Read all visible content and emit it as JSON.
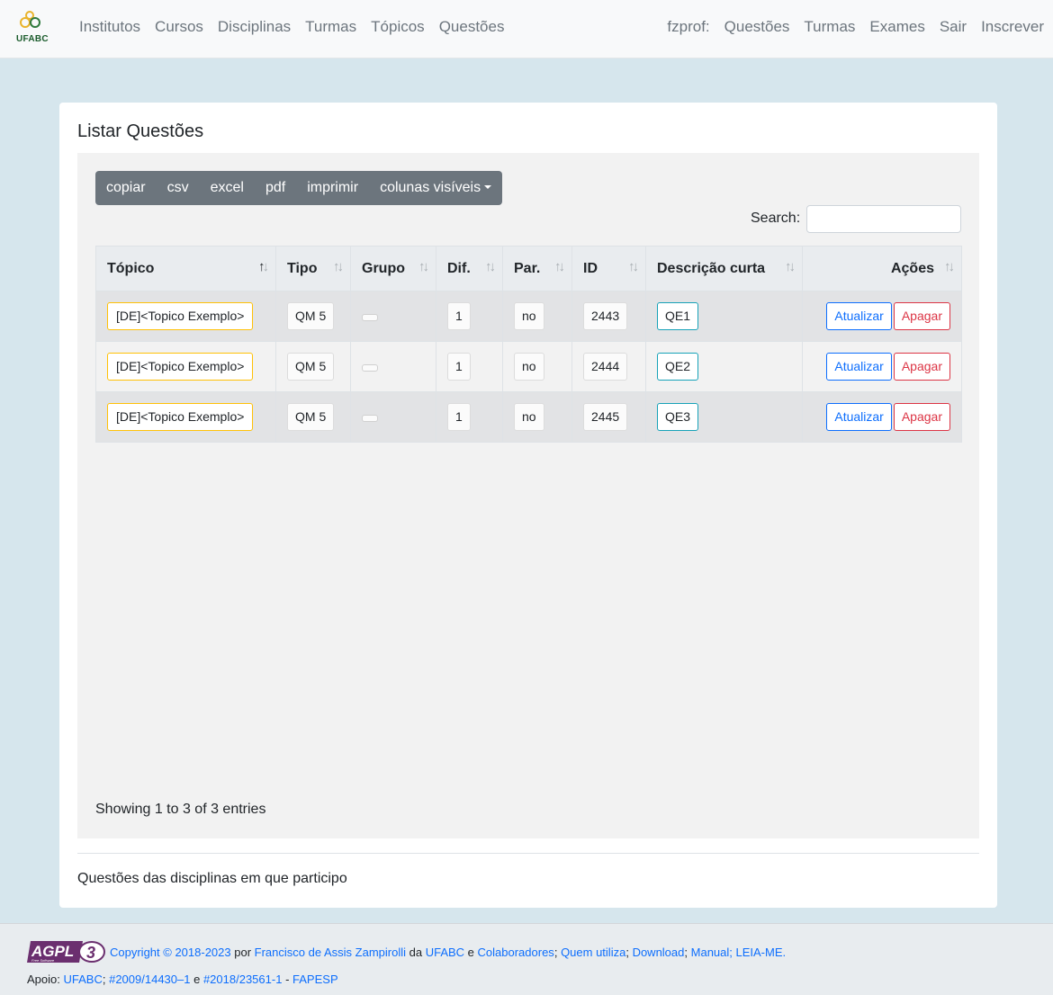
{
  "brand": {
    "logo_text": "UFABC"
  },
  "nav": {
    "left": [
      "Institutos",
      "Cursos",
      "Disciplinas",
      "Turmas",
      "Tópicos",
      "Questões"
    ],
    "right": [
      "fzprof:",
      "Questões",
      "Turmas",
      "Exames",
      "Sair",
      "Inscrever"
    ]
  },
  "page": {
    "title": "Listar Questões"
  },
  "toolbar": {
    "copy": "copiar",
    "csv": "csv",
    "excel": "excel",
    "pdf": "pdf",
    "print": "imprimir",
    "columns": "colunas visíveis"
  },
  "search": {
    "label": "Search:",
    "value": ""
  },
  "table": {
    "headers": [
      "Tópico",
      "Tipo",
      "Grupo",
      "Dif.",
      "Par.",
      "ID",
      "Descrição curta",
      "Ações"
    ],
    "sorted_column": "Tópico",
    "rows": [
      {
        "topico": "[DE]<Topico Exemplo>",
        "tipo": "QM 5",
        "grupo": "",
        "dif": "1",
        "par": "no",
        "id": "2443",
        "desc": "QE1",
        "update": "Atualizar",
        "delete": "Apagar"
      },
      {
        "topico": "[DE]<Topico Exemplo>",
        "tipo": "QM 5",
        "grupo": "",
        "dif": "1",
        "par": "no",
        "id": "2444",
        "desc": "QE2",
        "update": "Atualizar",
        "delete": "Apagar"
      },
      {
        "topico": "[DE]<Topico Exemplo>",
        "tipo": "QM 5",
        "grupo": "",
        "dif": "1",
        "par": "no",
        "id": "2445",
        "desc": "QE3",
        "update": "Atualizar",
        "delete": "Apagar"
      }
    ]
  },
  "info": "Showing 1 to 3 of 3 entries",
  "card_footer": "Questões das disciplinas em que participo",
  "footer": {
    "badge_text": "AGPL",
    "badge_version": "3",
    "badge_sub": "Free Software",
    "copyright": "Copyright © 2018-2023",
    "por": "por",
    "author": "Francisco de Assis Zampirolli",
    "da": "da",
    "ufabc": "UFABC",
    "e": "e",
    "colab": "Colaboradores",
    "sep": ";",
    "quem": "Quem utiliza",
    "download": "Download",
    "manual": "Manual; LEIA-ME.",
    "apoio": "Apoio:",
    "ufabc2": "UFABC",
    "grant1": "#2009/14430–1",
    "grant2": "#2018/23561-1",
    "dash": "-",
    "fapesp": "FAPESP"
  }
}
